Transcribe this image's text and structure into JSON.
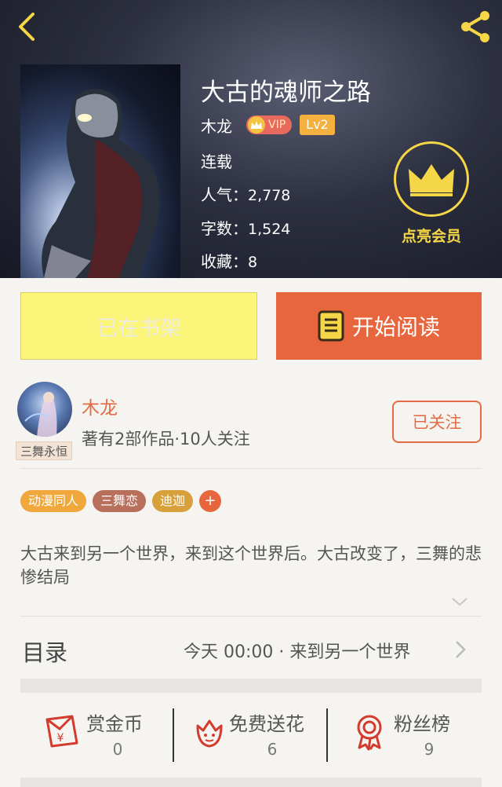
{
  "book": {
    "title": "大古的魂师之路",
    "author": "木龙",
    "vip_label": "VIP",
    "level": "Lv2",
    "status": "连载",
    "popularity_label": "人气：",
    "popularity": "2,778",
    "word_count_label": "字数：",
    "word_count": "1,524",
    "favorites_label": "收藏：",
    "favorites": "8"
  },
  "member": {
    "label": "点亮会员"
  },
  "actions": {
    "shelf_label": "已在书架",
    "read_label": "开始阅读"
  },
  "author_card": {
    "avatar_tag": "三舞永恒",
    "name": "木龙",
    "meta": "著有2部作品·10人关注",
    "follow_label": "已关注"
  },
  "tags": [
    {
      "label": "动漫同人",
      "color": "#f0a83c"
    },
    {
      "label": "三舞恋",
      "color": "#b86f5c"
    },
    {
      "label": "迪迦",
      "color": "#d8a03a"
    }
  ],
  "tag_more": "+",
  "description": "大古来到另一个世界，来到这个世界后。大古改变了，三舞的悲惨结局",
  "toc": {
    "label": "目录",
    "latest": "今天 00:00 · 来到另一个世界"
  },
  "stats": [
    {
      "icon": "red-envelope-icon",
      "label": "赏金币",
      "value": "0"
    },
    {
      "icon": "flower-icon",
      "label": "免费送花",
      "value": "6"
    },
    {
      "icon": "ribbon-medal-icon",
      "label": "粉丝榜",
      "value": "9"
    }
  ],
  "colors": {
    "accent": "#e8663e",
    "shelf_yellow": "#fbf57a",
    "member_gold": "#f5d646"
  }
}
